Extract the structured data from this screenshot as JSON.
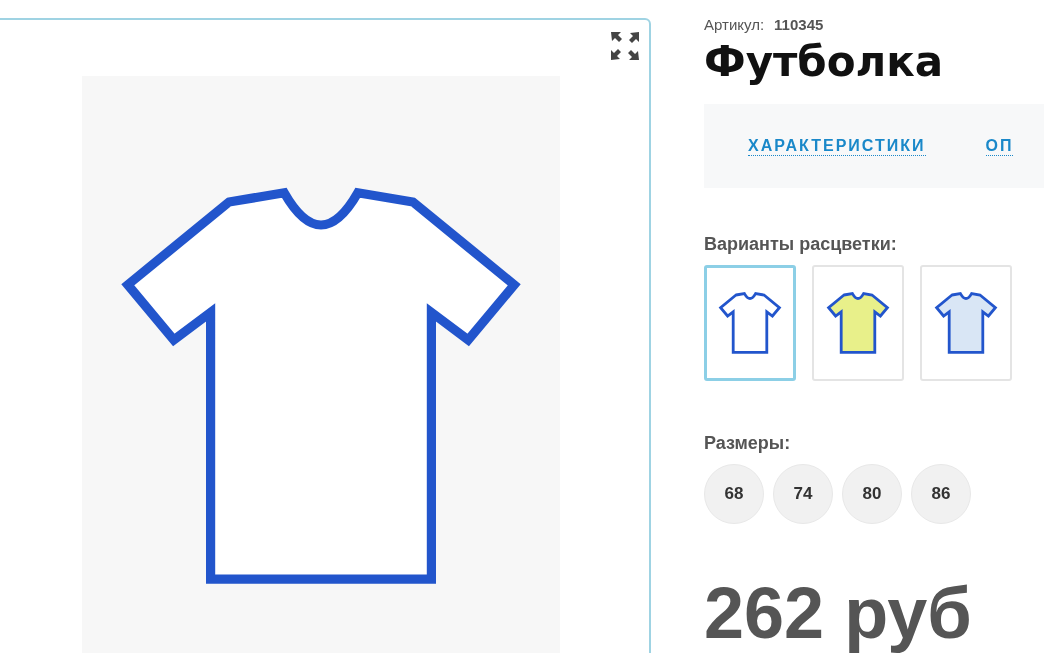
{
  "product": {
    "article_label": "Артикул:",
    "article_number": "110345",
    "title": "Футболка"
  },
  "tabs": [
    {
      "label": "ХАРАКТЕРИСТИКИ",
      "selected": false
    },
    {
      "label": "ОП",
      "selected": false
    }
  ],
  "colors": {
    "heading": "Варианты расцветки:",
    "variants": [
      {
        "color": "#ffffff",
        "selected": true
      },
      {
        "color": "#e8f08a",
        "selected": false
      },
      {
        "color": "#d9e6f5",
        "selected": false
      }
    ]
  },
  "sizes": {
    "heading": "Размеры:",
    "options": [
      {
        "label": "68",
        "selected": false
      },
      {
        "label": "74",
        "selected": false
      },
      {
        "label": "80",
        "selected": false
      },
      {
        "label": "86",
        "selected": false
      }
    ]
  },
  "price": "262 руб"
}
